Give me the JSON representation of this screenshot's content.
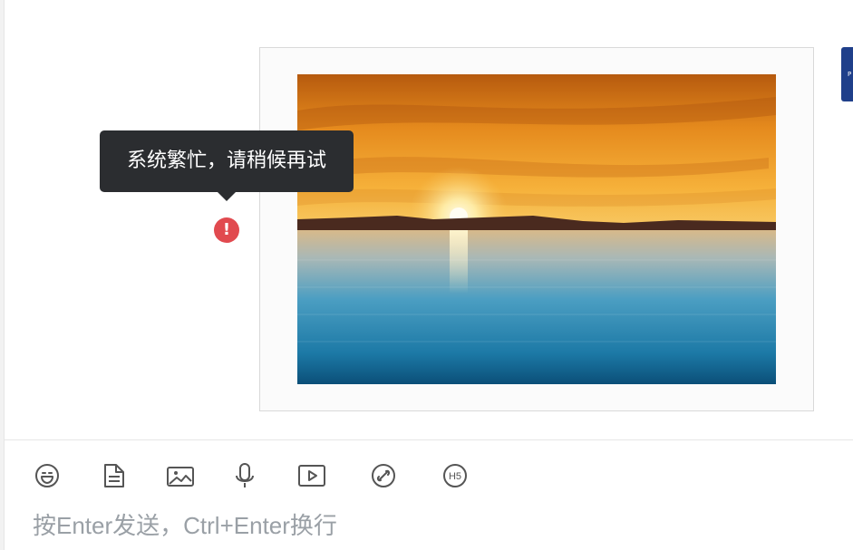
{
  "chat": {
    "message": {
      "error_tooltip": "系统繁忙，请稍候再试",
      "error_icon_glyph": "!"
    },
    "peer_avatar_label": "P"
  },
  "composer": {
    "placeholder": "按Enter发送，Ctrl+Enter换行",
    "toolbar": [
      {
        "name": "emoji-icon"
      },
      {
        "name": "file-icon"
      },
      {
        "name": "image-icon"
      },
      {
        "name": "microphone-icon"
      },
      {
        "name": "video-icon"
      },
      {
        "name": "link-icon"
      },
      {
        "name": "h5-icon",
        "label": "H5"
      }
    ]
  },
  "colors": {
    "tooltip_bg": "#2b2d30",
    "error_red": "#e14a4f",
    "icon_gray": "#555555",
    "peer_avatar_blue": "#1f3f8a"
  }
}
